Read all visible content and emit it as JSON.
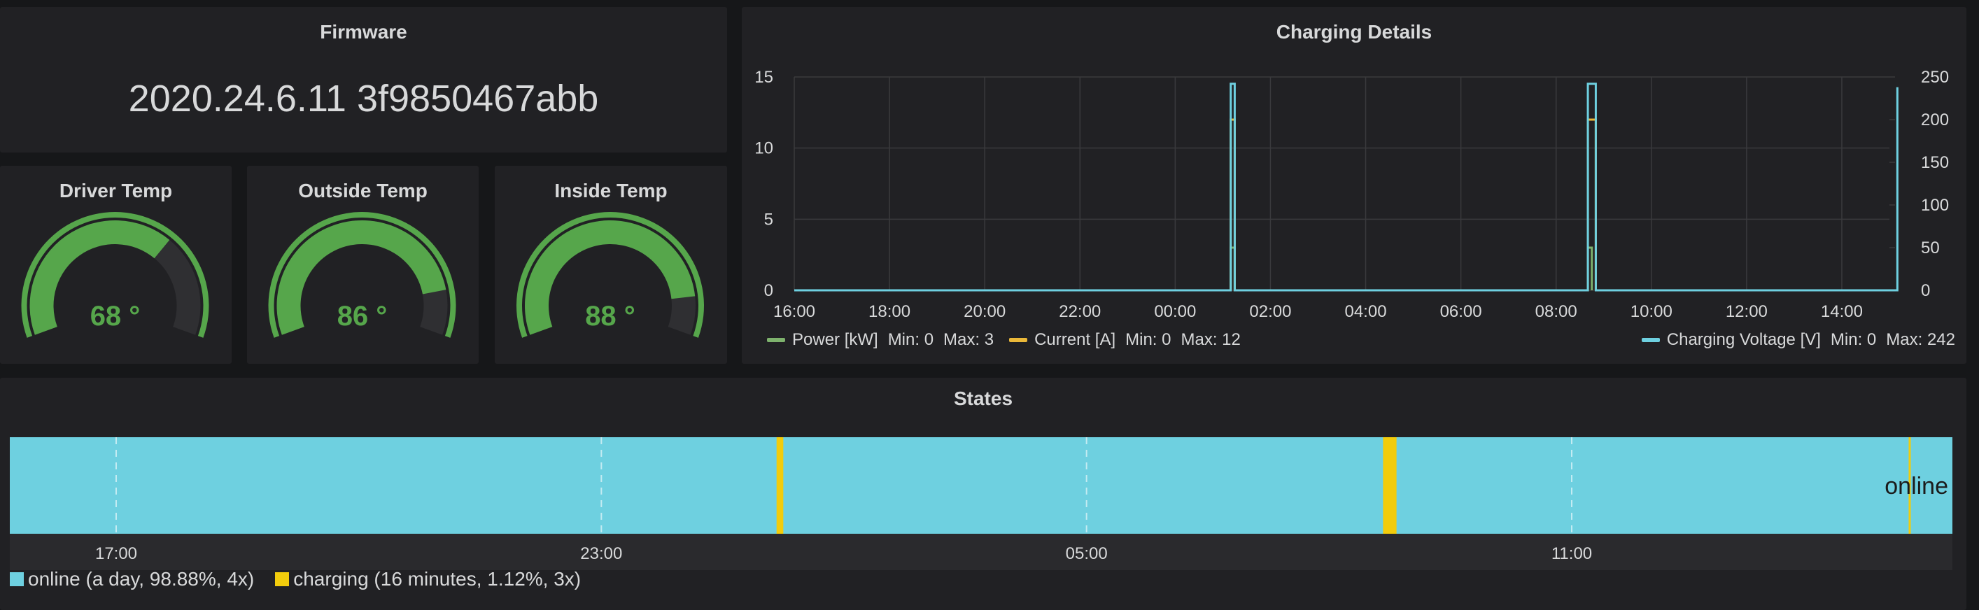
{
  "firmware": {
    "title": "Firmware",
    "value": "2020.24.6.11 3f9850467abb"
  },
  "gauges": [
    {
      "title": "Driver Temp",
      "value": 68,
      "display": "68 °",
      "fill_fraction": 0.68
    },
    {
      "title": "Outside Temp",
      "value": 86,
      "display": "86 °",
      "fill_fraction": 0.86
    },
    {
      "title": "Inside Temp",
      "value": 88,
      "display": "88 °",
      "fill_fraction": 0.88
    }
  ],
  "colors": {
    "background": "#161719",
    "panel": "#212124",
    "gauge_green": "#56a64b",
    "gauge_track": "#2f2f32",
    "power": "#7eb26d",
    "current": "#eab839",
    "voltage": "#6ed0e0",
    "online": "#6ed0e0",
    "charging": "#f2cc0c",
    "grid": "#3a3a3d",
    "text": "#d8d9da"
  },
  "charging_details": {
    "title": "Charging Details",
    "legend": {
      "power": {
        "label": "Power [kW]",
        "min": "Min: 0",
        "max": "Max: 3"
      },
      "current": {
        "label": "Current [A]",
        "min": "Min: 0",
        "max": "Max: 12"
      },
      "voltage": {
        "label": "Charging Voltage [V]",
        "min": "Min: 0",
        "max": "Max: 242"
      }
    }
  },
  "chart_data": [
    {
      "type": "line",
      "title": "Charging Details",
      "x_ticks": [
        "16:00",
        "18:00",
        "20:00",
        "22:00",
        "00:00",
        "02:00",
        "04:00",
        "06:00",
        "08:00",
        "10:00",
        "12:00",
        "14:00"
      ],
      "y_left_ticks": [
        "0",
        "5",
        "10",
        "15"
      ],
      "y_right_ticks": [
        "0",
        "50",
        "100",
        "150",
        "200",
        "250"
      ],
      "ylim_left": [
        0,
        15
      ],
      "ylim_right": [
        0,
        250
      ],
      "grid": true,
      "series": [
        {
          "name": "Power [kW]",
          "axis": "left",
          "x": [
            "01:10",
            "01:10",
            "01:15",
            "01:15",
            "08:40",
            "08:40",
            "08:45",
            "08:45"
          ],
          "y": [
            0,
            3,
            3,
            0,
            0,
            3,
            3,
            0
          ]
        },
        {
          "name": "Current [A]",
          "axis": "left",
          "x": [
            "01:10",
            "01:10",
            "01:15",
            "01:15",
            "08:40",
            "08:40",
            "08:50",
            "08:50"
          ],
          "y": [
            0,
            12,
            12,
            0,
            0,
            12,
            12,
            0
          ]
        },
        {
          "name": "Charging Voltage [V]",
          "axis": "right",
          "x": [
            "16:00",
            "01:10",
            "01:10",
            "01:15",
            "01:15",
            "08:40",
            "08:40",
            "08:50",
            "08:50",
            "15:10",
            "15:10"
          ],
          "y": [
            0,
            0,
            242,
            242,
            0,
            0,
            242,
            242,
            0,
            0,
            238
          ]
        }
      ],
      "legend_position": "bottom"
    },
    {
      "type": "bar",
      "title": "States",
      "x_ticks": [
        "17:00",
        "23:00",
        "05:00",
        "11:00"
      ],
      "series": [
        {
          "name": "online",
          "summary": "online (a day, 98.88%, 4x)"
        },
        {
          "name": "charging",
          "summary": "charging (16 minutes, 1.12%, 3x)"
        }
      ],
      "segments": [
        {
          "state": "charging",
          "start": "01:10",
          "end": "01:15"
        },
        {
          "state": "charging",
          "start": "08:40",
          "end": "08:50"
        },
        {
          "state": "charging",
          "start": "15:10",
          "end": "15:11"
        }
      ],
      "bar_label": "online",
      "legend_position": "bottom-left"
    }
  ],
  "states": {
    "title": "States",
    "bar_label": "online",
    "legend": {
      "online": "online (a day, 98.88%, 4x)",
      "charging": "charging (16 minutes, 1.12%, 3x)"
    }
  }
}
